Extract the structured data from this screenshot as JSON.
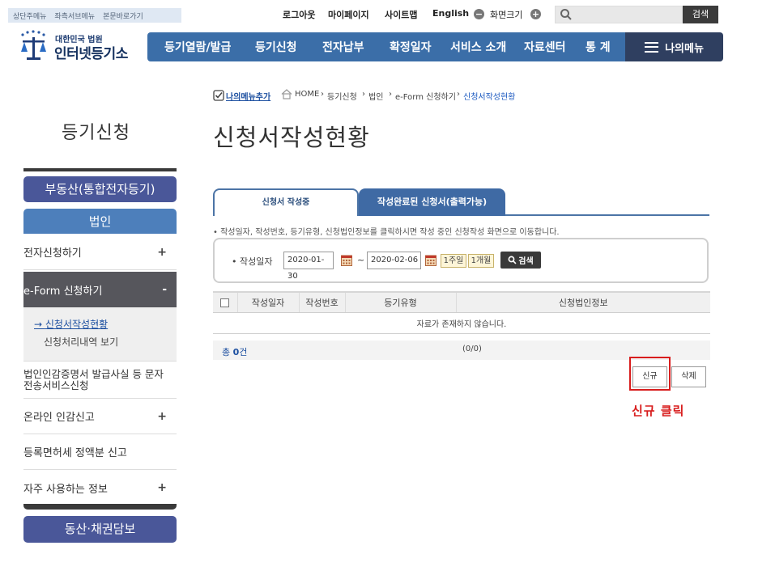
{
  "skipnav": [
    "상단주메뉴",
    "좌측서브메뉴",
    "본문바로가기"
  ],
  "util": {
    "logout": "로그아웃",
    "mypage": "마이페이지",
    "sitemap": "사이트맵",
    "english": "English",
    "screen_size": "화면크기",
    "search_button": "검색"
  },
  "logo": {
    "small": "대한민국 법원",
    "big": "인터넷등기소"
  },
  "gnb": [
    "등기열람/발급",
    "등기신청",
    "전자납부",
    "확정일자",
    "서비스 소개",
    "자료센터",
    "통 계"
  ],
  "my_menu": "나의메뉴",
  "breadcrumb": {
    "add_menu": "나의메뉴추가",
    "items": [
      "HOME",
      "등기신청",
      "법인",
      "e-Form 신청하기"
    ],
    "current": "신청서작성현황"
  },
  "sidebar": {
    "title": "등기신청",
    "realestate": "부동산(통합전자등기)",
    "corporation": "법인",
    "items": [
      {
        "label": "전자신청하기",
        "toggle": "+"
      },
      {
        "label": "e-Form 신청하기",
        "toggle": "-"
      },
      {
        "label": "법인인감증명서 발급사실 등 문자전송서비스신청",
        "toggle": ""
      },
      {
        "label": "온라인 인감신고",
        "toggle": "+"
      },
      {
        "label": "등록면허세 정액분 신고",
        "toggle": ""
      },
      {
        "label": "자주 사용하는 정보",
        "toggle": "+"
      }
    ],
    "sub_items": [
      "신청서작성현황",
      "신청처리내역 보기"
    ],
    "movable": "동산·채권담보"
  },
  "page_title": "신청서작성현황",
  "tabs": [
    "신청서 작성중",
    "작성완료된 신청서(출력가능)"
  ],
  "notice": "• 작성일자, 작성번호, 등기유형, 신청법인정보를 클릭하시면 작성 중인 신청작성 화면으로 이동합니다.",
  "search_form": {
    "label": "• 작성일자",
    "date_from": "2020-01-30",
    "date_to": "2020-02-06",
    "tilde": "~",
    "week_btn": "1주일",
    "month_btn": "1개월",
    "search_btn": "검색"
  },
  "table": {
    "headers": [
      "작성일자",
      "작성번호",
      "등기유형",
      "신청법인정보"
    ],
    "empty_message": "자료가 존재하지 않습니다."
  },
  "total": {
    "prefix": "총 ",
    "count": "0",
    "suffix": "건"
  },
  "paging": "(0/0)",
  "buttons": {
    "new": "신규",
    "delete": "삭제"
  },
  "annotation": "신규 클릭",
  "colors": {
    "gnb": "#3b6ea8",
    "my_menu": "#2f3f60",
    "sidebar_button": "#4a5799",
    "sidebar_active": "#56565c",
    "tab_active_border": "#4c74a6",
    "highlight": "#d81d1d"
  }
}
